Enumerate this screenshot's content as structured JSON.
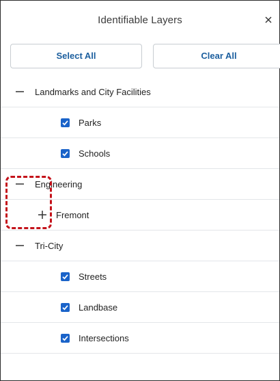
{
  "header": {
    "title": "Identifiable Layers",
    "close_icon": "close-icon"
  },
  "buttons": {
    "select_all": "Select All",
    "clear_all": "Clear All"
  },
  "groups": [
    {
      "label": "Landmarks and City Facilities",
      "expanded": true,
      "layers": [
        {
          "label": "Parks",
          "checked": true
        },
        {
          "label": "Schools",
          "checked": true
        }
      ]
    },
    {
      "label": "Engineering",
      "expanded": true,
      "subgroups": [
        {
          "label": "Fremont",
          "expanded": false
        }
      ]
    },
    {
      "label": "Tri-City",
      "expanded": true,
      "layers": [
        {
          "label": "Streets",
          "checked": true
        },
        {
          "label": "Landbase",
          "checked": true
        },
        {
          "label": "Intersections",
          "checked": true
        }
      ]
    }
  ],
  "colors": {
    "accent": "#1b5e9e",
    "checkbox": "#1a63c9",
    "highlight": "#c4121a"
  }
}
